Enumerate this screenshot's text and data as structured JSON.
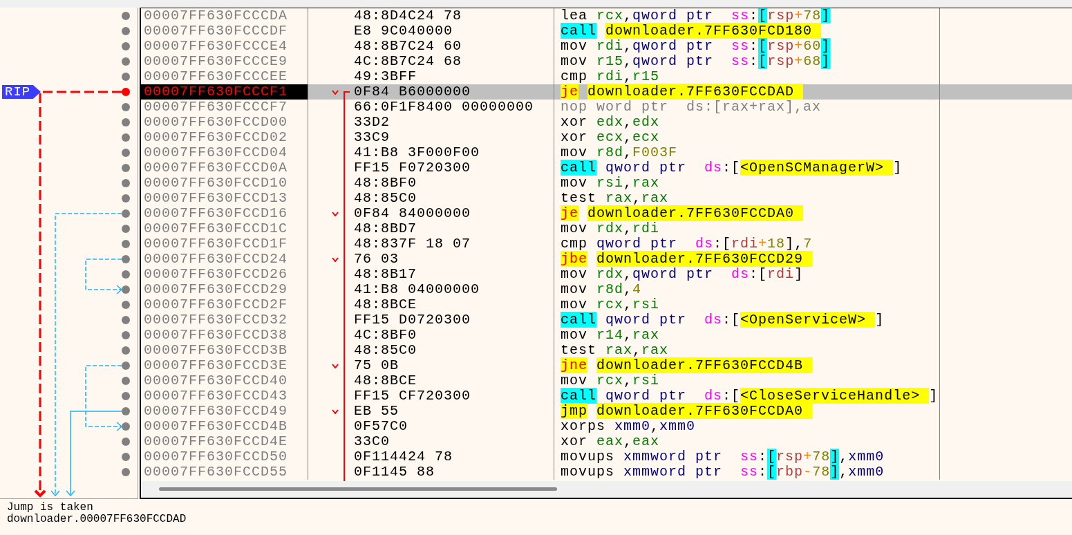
{
  "gutter": {
    "rip_label": "RIP"
  },
  "rows": [
    {
      "address": "00007FF630FCCCDA",
      "bytes": "48:8D4C24 78",
      "instruction": [
        {
          "text": "lea ",
          "kind": "mnemonic"
        },
        {
          "text": "rcx",
          "kind": "register"
        },
        {
          "text": ",",
          "kind": "plain"
        },
        {
          "text": "qword ptr  ",
          "kind": "size"
        },
        {
          "text": "ss",
          "kind": "segment"
        },
        {
          "text": ":",
          "kind": "plain"
        },
        {
          "text": "[",
          "kind": "bracket_highlight"
        },
        {
          "text": "rsp",
          "kind": "memory_register"
        },
        {
          "text": "+",
          "kind": "operator"
        },
        {
          "text": "78",
          "kind": "number"
        },
        {
          "text": "]",
          "kind": "bracket_highlight"
        }
      ],
      "current": false,
      "kind": "instruction",
      "branch_target": false
    },
    {
      "address": "00007FF630FCCCDF",
      "bytes": "E8 9C040000",
      "instruction": [
        {
          "text": "call ",
          "kind": "call"
        },
        {
          "text": "downloader.7FF630FCD180",
          "kind": "target"
        }
      ],
      "current": false,
      "kind": "instruction",
      "branch_target": false
    },
    {
      "address": "00007FF630FCCCE4",
      "bytes": "48:8B7C24 60",
      "instruction": [
        {
          "text": "mov ",
          "kind": "mnemonic"
        },
        {
          "text": "rdi",
          "kind": "register"
        },
        {
          "text": ",",
          "kind": "plain"
        },
        {
          "text": "qword ptr  ",
          "kind": "size"
        },
        {
          "text": "ss",
          "kind": "segment"
        },
        {
          "text": ":",
          "kind": "plain"
        },
        {
          "text": "[",
          "kind": "bracket_highlight"
        },
        {
          "text": "rsp",
          "kind": "memory_register"
        },
        {
          "text": "+",
          "kind": "operator"
        },
        {
          "text": "60",
          "kind": "number"
        },
        {
          "text": "]",
          "kind": "bracket_highlight"
        }
      ],
      "current": false,
      "kind": "instruction",
      "branch_target": false
    },
    {
      "address": "00007FF630FCCCE9",
      "bytes": "4C:8B7C24 68",
      "instruction": [
        {
          "text": "mov ",
          "kind": "mnemonic"
        },
        {
          "text": "r15",
          "kind": "register"
        },
        {
          "text": ",",
          "kind": "plain"
        },
        {
          "text": "qword ptr  ",
          "kind": "size"
        },
        {
          "text": "ss",
          "kind": "segment"
        },
        {
          "text": ":",
          "kind": "plain"
        },
        {
          "text": "[",
          "kind": "bracket_highlight"
        },
        {
          "text": "rsp",
          "kind": "memory_register"
        },
        {
          "text": "+",
          "kind": "operator"
        },
        {
          "text": "68",
          "kind": "number"
        },
        {
          "text": "]",
          "kind": "bracket_highlight"
        }
      ],
      "current": false,
      "kind": "instruction",
      "branch_target": false
    },
    {
      "address": "00007FF630FCCCEE",
      "bytes": "49:3BFF",
      "instruction": [
        {
          "text": "cmp ",
          "kind": "mnemonic"
        },
        {
          "text": "rdi",
          "kind": "register"
        },
        {
          "text": ",",
          "kind": "plain"
        },
        {
          "text": "r15",
          "kind": "register"
        }
      ],
      "current": false,
      "kind": "instruction",
      "branch_target": false
    },
    {
      "address": "00007FF630FCCCF1",
      "bytes": "0F84 B6000000",
      "instruction": [
        {
          "text": "je ",
          "kind": "jcc"
        },
        {
          "text": "downloader.7FF630FCCDAD",
          "kind": "target"
        }
      ],
      "current": true,
      "kind": "conditional_jump",
      "target_visible": false,
      "branch_target": false
    },
    {
      "address": "00007FF630FCCCF7",
      "bytes": "66:0F1F8400 00000000",
      "instruction": [
        {
          "text": "nop word ptr  ds:[rax+rax],ax",
          "kind": "nop"
        }
      ],
      "current": false,
      "kind": "instruction",
      "branch_target": false
    },
    {
      "address": "00007FF630FCCD00",
      "bytes": "33D2",
      "instruction": [
        {
          "text": "xor ",
          "kind": "mnemonic"
        },
        {
          "text": "edx",
          "kind": "register"
        },
        {
          "text": ",",
          "kind": "plain"
        },
        {
          "text": "edx",
          "kind": "register"
        }
      ],
      "current": false,
      "kind": "instruction",
      "branch_target": false
    },
    {
      "address": "00007FF630FCCD02",
      "bytes": "33C9",
      "instruction": [
        {
          "text": "xor ",
          "kind": "mnemonic"
        },
        {
          "text": "ecx",
          "kind": "register"
        },
        {
          "text": ",",
          "kind": "plain"
        },
        {
          "text": "ecx",
          "kind": "register"
        }
      ],
      "current": false,
      "kind": "instruction",
      "branch_target": false
    },
    {
      "address": "00007FF630FCCD04",
      "bytes": "41:B8 3F000F00",
      "instruction": [
        {
          "text": "mov ",
          "kind": "mnemonic"
        },
        {
          "text": "r8d",
          "kind": "register"
        },
        {
          "text": ",",
          "kind": "plain"
        },
        {
          "text": "F003F",
          "kind": "number"
        }
      ],
      "current": false,
      "kind": "instruction",
      "branch_target": false
    },
    {
      "address": "00007FF630FCCD0A",
      "bytes": "FF15 F0720300",
      "instruction": [
        {
          "text": "call ",
          "kind": "call"
        },
        {
          "text": "qword ptr  ",
          "kind": "size"
        },
        {
          "text": "ds",
          "kind": "segment"
        },
        {
          "text": ":[",
          "kind": "plain"
        },
        {
          "text": "<OpenSCManagerW>",
          "kind": "api"
        },
        {
          "text": "]",
          "kind": "plain"
        }
      ],
      "current": false,
      "kind": "instruction",
      "branch_target": false
    },
    {
      "address": "00007FF630FCCD10",
      "bytes": "48:8BF0",
      "instruction": [
        {
          "text": "mov ",
          "kind": "mnemonic"
        },
        {
          "text": "rsi",
          "kind": "register"
        },
        {
          "text": ",",
          "kind": "plain"
        },
        {
          "text": "rax",
          "kind": "register"
        }
      ],
      "current": false,
      "kind": "instruction",
      "branch_target": false
    },
    {
      "address": "00007FF630FCCD13",
      "bytes": "48:85C0",
      "instruction": [
        {
          "text": "test ",
          "kind": "mnemonic"
        },
        {
          "text": "rax",
          "kind": "register"
        },
        {
          "text": ",",
          "kind": "plain"
        },
        {
          "text": "rax",
          "kind": "register"
        }
      ],
      "current": false,
      "kind": "instruction",
      "branch_target": false
    },
    {
      "address": "00007FF630FCCD16",
      "bytes": "0F84 84000000",
      "instruction": [
        {
          "text": "je ",
          "kind": "jcc"
        },
        {
          "text": "downloader.7FF630FCCDA0",
          "kind": "target"
        }
      ],
      "current": false,
      "kind": "conditional_jump",
      "target_visible": false,
      "branch_target": false
    },
    {
      "address": "00007FF630FCCD1C",
      "bytes": "48:8BD7",
      "instruction": [
        {
          "text": "mov ",
          "kind": "mnemonic"
        },
        {
          "text": "rdx",
          "kind": "register"
        },
        {
          "text": ",",
          "kind": "plain"
        },
        {
          "text": "rdi",
          "kind": "register"
        }
      ],
      "current": false,
      "kind": "instruction",
      "branch_target": false
    },
    {
      "address": "00007FF630FCCD1F",
      "bytes": "48:837F 18 07",
      "instruction": [
        {
          "text": "cmp ",
          "kind": "mnemonic"
        },
        {
          "text": "qword ptr  ",
          "kind": "size"
        },
        {
          "text": "ds",
          "kind": "segment"
        },
        {
          "text": ":[",
          "kind": "plain"
        },
        {
          "text": "rdi",
          "kind": "memory_register"
        },
        {
          "text": "+",
          "kind": "operator"
        },
        {
          "text": "18",
          "kind": "number"
        },
        {
          "text": "],",
          "kind": "plain"
        },
        {
          "text": "7",
          "kind": "number"
        }
      ],
      "current": false,
      "kind": "instruction",
      "branch_target": false
    },
    {
      "address": "00007FF630FCCD24",
      "bytes": "76 03",
      "instruction": [
        {
          "text": "jbe ",
          "kind": "jcc"
        },
        {
          "text": "downloader.7FF630FCCD29",
          "kind": "target"
        }
      ],
      "current": false,
      "kind": "conditional_jump",
      "target_visible": true,
      "branch_target": false
    },
    {
      "address": "00007FF630FCCD26",
      "bytes": "48:8B17",
      "instruction": [
        {
          "text": "mov ",
          "kind": "mnemonic"
        },
        {
          "text": "rdx",
          "kind": "register"
        },
        {
          "text": ",",
          "kind": "plain"
        },
        {
          "text": "qword ptr  ",
          "kind": "size"
        },
        {
          "text": "ds",
          "kind": "segment"
        },
        {
          "text": ":[",
          "kind": "plain"
        },
        {
          "text": "rdi",
          "kind": "memory_register"
        },
        {
          "text": "]",
          "kind": "plain"
        }
      ],
      "current": false,
      "kind": "instruction",
      "branch_target": false
    },
    {
      "address": "00007FF630FCCD29",
      "bytes": "41:B8 04000000",
      "instruction": [
        {
          "text": "mov ",
          "kind": "mnemonic"
        },
        {
          "text": "r8d",
          "kind": "register"
        },
        {
          "text": ",",
          "kind": "plain"
        },
        {
          "text": "4",
          "kind": "number"
        }
      ],
      "current": false,
      "kind": "instruction",
      "branch_target": true
    },
    {
      "address": "00007FF630FCCD2F",
      "bytes": "48:8BCE",
      "instruction": [
        {
          "text": "mov ",
          "kind": "mnemonic"
        },
        {
          "text": "rcx",
          "kind": "register"
        },
        {
          "text": ",",
          "kind": "plain"
        },
        {
          "text": "rsi",
          "kind": "register"
        }
      ],
      "current": false,
      "kind": "instruction",
      "branch_target": false
    },
    {
      "address": "00007FF630FCCD32",
      "bytes": "FF15 D0720300",
      "instruction": [
        {
          "text": "call ",
          "kind": "call"
        },
        {
          "text": "qword ptr  ",
          "kind": "size"
        },
        {
          "text": "ds",
          "kind": "segment"
        },
        {
          "text": ":[",
          "kind": "plain"
        },
        {
          "text": "<OpenServiceW>",
          "kind": "api"
        },
        {
          "text": "]",
          "kind": "plain"
        }
      ],
      "current": false,
      "kind": "instruction",
      "branch_target": false
    },
    {
      "address": "00007FF630FCCD38",
      "bytes": "4C:8BF0",
      "instruction": [
        {
          "text": "mov ",
          "kind": "mnemonic"
        },
        {
          "text": "r14",
          "kind": "register"
        },
        {
          "text": ",",
          "kind": "plain"
        },
        {
          "text": "rax",
          "kind": "register"
        }
      ],
      "current": false,
      "kind": "instruction",
      "branch_target": false
    },
    {
      "address": "00007FF630FCCD3B",
      "bytes": "48:85C0",
      "instruction": [
        {
          "text": "test ",
          "kind": "mnemonic"
        },
        {
          "text": "rax",
          "kind": "register"
        },
        {
          "text": ",",
          "kind": "plain"
        },
        {
          "text": "rax",
          "kind": "register"
        }
      ],
      "current": false,
      "kind": "instruction",
      "branch_target": false
    },
    {
      "address": "00007FF630FCCD3E",
      "bytes": "75 0B",
      "instruction": [
        {
          "text": "jne ",
          "kind": "jcc"
        },
        {
          "text": "downloader.7FF630FCCD4B",
          "kind": "target"
        }
      ],
      "current": false,
      "kind": "conditional_jump",
      "target_visible": true,
      "branch_target": false
    },
    {
      "address": "00007FF630FCCD40",
      "bytes": "48:8BCE",
      "instruction": [
        {
          "text": "mov ",
          "kind": "mnemonic"
        },
        {
          "text": "rcx",
          "kind": "register"
        },
        {
          "text": ",",
          "kind": "plain"
        },
        {
          "text": "rsi",
          "kind": "register"
        }
      ],
      "current": false,
      "kind": "instruction",
      "branch_target": false
    },
    {
      "address": "00007FF630FCCD43",
      "bytes": "FF15 CF720300",
      "instruction": [
        {
          "text": "call ",
          "kind": "call"
        },
        {
          "text": "qword ptr  ",
          "kind": "size"
        },
        {
          "text": "ds",
          "kind": "segment"
        },
        {
          "text": ":[",
          "kind": "plain"
        },
        {
          "text": "<CloseServiceHandle>",
          "kind": "api"
        },
        {
          "text": "]",
          "kind": "plain"
        }
      ],
      "current": false,
      "kind": "instruction",
      "branch_target": false
    },
    {
      "address": "00007FF630FCCD49",
      "bytes": "EB 55",
      "instruction": [
        {
          "text": "jmp ",
          "kind": "jmp"
        },
        {
          "text": "downloader.7FF630FCCDA0",
          "kind": "target"
        }
      ],
      "current": false,
      "kind": "unconditional_jump",
      "target_visible": false,
      "branch_target": false
    },
    {
      "address": "00007FF630FCCD4B",
      "bytes": "0F57C0",
      "instruction": [
        {
          "text": "xorps ",
          "kind": "mnemonic"
        },
        {
          "text": "xmm0",
          "kind": "vector_register"
        },
        {
          "text": ",",
          "kind": "plain"
        },
        {
          "text": "xmm0",
          "kind": "vector_register"
        }
      ],
      "current": false,
      "kind": "instruction",
      "branch_target": true
    },
    {
      "address": "00007FF630FCCD4E",
      "bytes": "33C0",
      "instruction": [
        {
          "text": "xor ",
          "kind": "mnemonic"
        },
        {
          "text": "eax",
          "kind": "register"
        },
        {
          "text": ",",
          "kind": "plain"
        },
        {
          "text": "eax",
          "kind": "register"
        }
      ],
      "current": false,
      "kind": "instruction",
      "branch_target": false
    },
    {
      "address": "00007FF630FCCD50",
      "bytes": "0F114424 78",
      "instruction": [
        {
          "text": "movups ",
          "kind": "mnemonic"
        },
        {
          "text": "xmmword ptr  ",
          "kind": "size"
        },
        {
          "text": "ss",
          "kind": "segment"
        },
        {
          "text": ":",
          "kind": "plain"
        },
        {
          "text": "[",
          "kind": "bracket_highlight"
        },
        {
          "text": "rsp",
          "kind": "memory_register"
        },
        {
          "text": "+",
          "kind": "operator"
        },
        {
          "text": "78",
          "kind": "number"
        },
        {
          "text": "]",
          "kind": "bracket_highlight"
        },
        {
          "text": ",",
          "kind": "plain"
        },
        {
          "text": "xmm0",
          "kind": "vector_register"
        }
      ],
      "current": false,
      "kind": "instruction",
      "branch_target": false
    },
    {
      "address": "00007FF630FCCD55",
      "bytes": "0F1145 88",
      "instruction": [
        {
          "text": "movups ",
          "kind": "mnemonic"
        },
        {
          "text": "xmmword ptr  ",
          "kind": "size"
        },
        {
          "text": "ss",
          "kind": "segment"
        },
        {
          "text": ":",
          "kind": "plain"
        },
        {
          "text": "[",
          "kind": "bracket_highlight"
        },
        {
          "text": "rbp",
          "kind": "memory_register"
        },
        {
          "text": "-",
          "kind": "operator"
        },
        {
          "text": "78",
          "kind": "number"
        },
        {
          "text": "]",
          "kind": "bracket_highlight"
        },
        {
          "text": ",",
          "kind": "plain"
        },
        {
          "text": "xmm0",
          "kind": "vector_register"
        }
      ],
      "current": false,
      "kind": "instruction",
      "branch_target": false
    }
  ],
  "info_panel": {
    "lines": [
      "Jump is taken",
      "downloader.00007FF630FCCDAD"
    ]
  }
}
